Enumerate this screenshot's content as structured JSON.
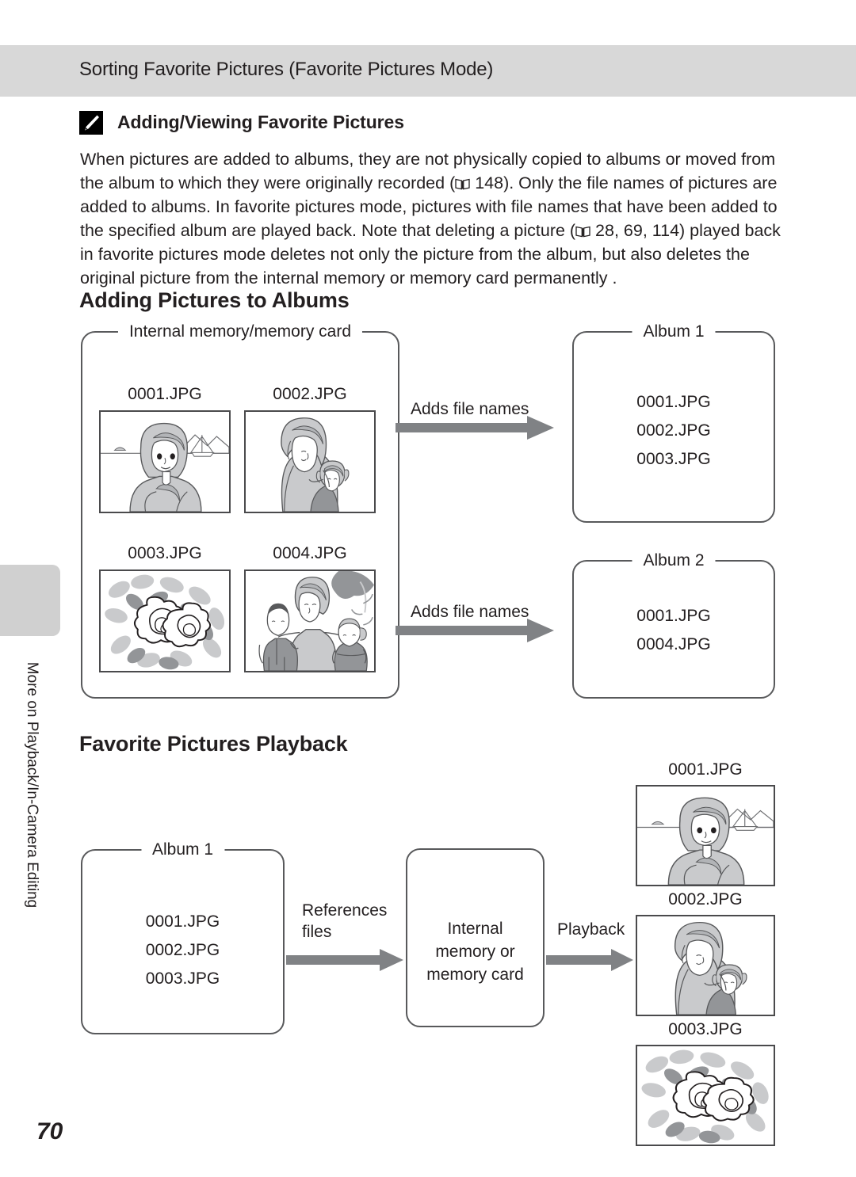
{
  "header": {
    "running_title": "Sorting Favorite Pictures (Favorite Pictures Mode)"
  },
  "side_tab": {
    "chapter_label": "More on Playback/In-Camera Editing"
  },
  "page_number": "70",
  "note": {
    "icon": "pencil-note-icon",
    "heading": "Adding/Viewing Favorite Pictures",
    "body_part1": "When pictures are added to albums, they are not physically copied to albums or moved from the album to which they were originally recorded (",
    "ref1": " 148). Only the file names of pictures are added to albums. In favorite pictures mode, pictures with file names that have been added to the specified album are played back. Note that deleting a picture (",
    "ref2": " 28, 69, 114) played back in favorite pictures mode deletes not only the picture from the album, but also deletes the original picture from the internal memory or memory card permanently ."
  },
  "adding_section": {
    "heading": "Adding Pictures to Albums",
    "source_box": {
      "title": "Internal memory/memory card",
      "photos": [
        {
          "caption": "0001.JPG",
          "art": "seaside-portrait"
        },
        {
          "caption": "0002.JPG",
          "art": "mother-and-child"
        },
        {
          "caption": "0003.JPG",
          "art": "roses"
        },
        {
          "caption": "0004.JPG",
          "art": "family-outdoors"
        }
      ]
    },
    "arrows": [
      {
        "label": "Adds file names"
      },
      {
        "label": "Adds file names"
      }
    ],
    "albums": [
      {
        "title": "Album 1",
        "files": [
          "0001.JPG",
          "0002.JPG",
          "0003.JPG"
        ]
      },
      {
        "title": "Album 2",
        "files": [
          "0001.JPG",
          "0004.JPG"
        ]
      }
    ]
  },
  "playback_section": {
    "heading": "Favorite Pictures Playback",
    "album_box": {
      "title": "Album 1",
      "files": [
        "0001.JPG",
        "0002.JPG",
        "0003.JPG"
      ]
    },
    "arrow1_label": "References\nfiles",
    "memory_box": {
      "lines": [
        "Internal",
        "memory or",
        "memory card"
      ]
    },
    "arrow2_label": "Playback",
    "photos": [
      {
        "caption": "0001.JPG",
        "art": "seaside-portrait"
      },
      {
        "caption": "0002.JPG",
        "art": "mother-and-child"
      },
      {
        "caption": "0003.JPG",
        "art": "roses"
      }
    ]
  },
  "colors": {
    "header_band": "#d8d8d8",
    "tab_block": "#d0d0d0",
    "box_border": "#58595b",
    "arrow": "#808285",
    "art_light": "#c9cacc",
    "art_mid": "#b2b4b7",
    "art_dark": "#939598",
    "ink": "#231f20"
  }
}
